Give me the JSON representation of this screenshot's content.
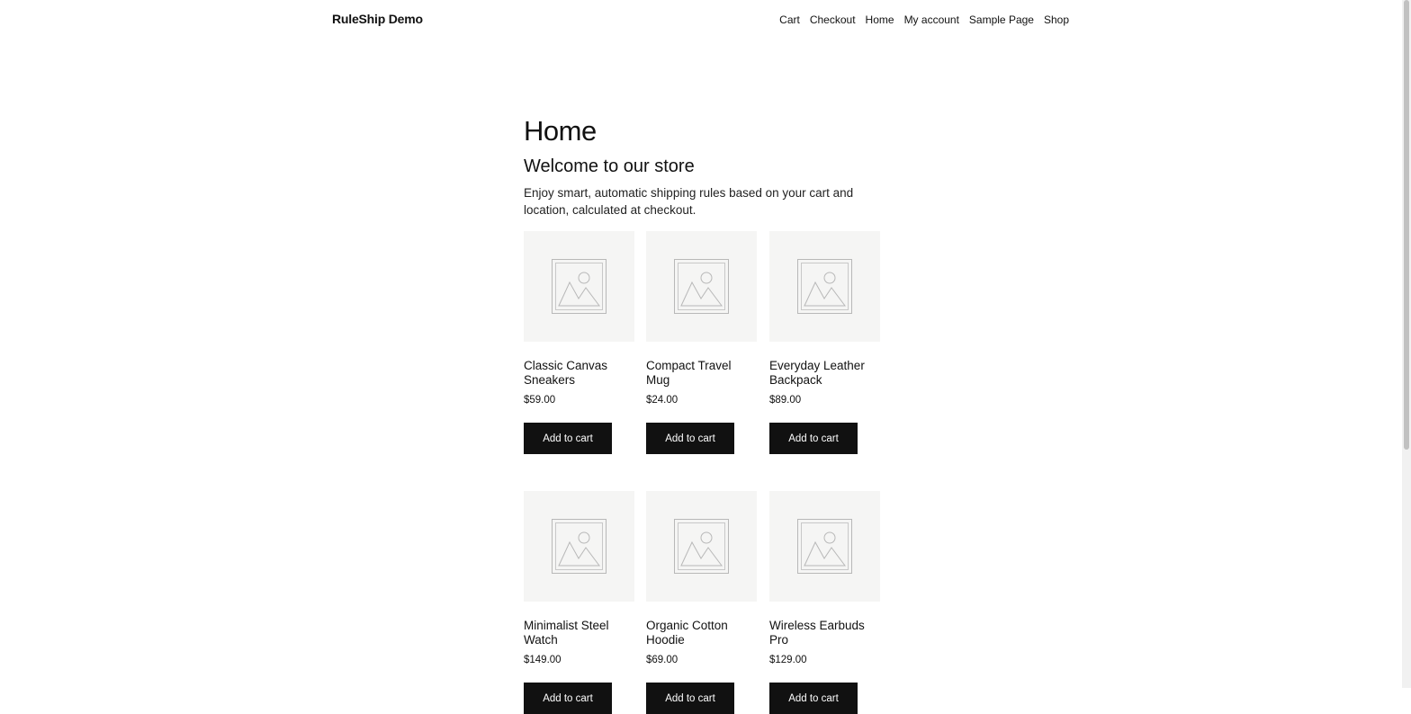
{
  "header": {
    "site_title": "RuleShip Demo",
    "nav": [
      "Cart",
      "Checkout",
      "Home",
      "My account",
      "Sample Page",
      "Shop"
    ]
  },
  "main": {
    "page_title": "Home",
    "welcome": "Welcome to our store",
    "intro": "Enjoy smart, automatic shipping rules based on your cart and location, calculated at checkout."
  },
  "products": [
    {
      "name": "Classic Canvas Sneakers",
      "price": "$59.00",
      "button": "Add to cart"
    },
    {
      "name": "Compact Travel Mug",
      "price": "$24.00",
      "button": "Add to cart"
    },
    {
      "name": "Everyday Leather Backpack",
      "price": "$89.00",
      "button": "Add to cart"
    },
    {
      "name": "Minimalist Steel Watch",
      "price": "$149.00",
      "button": "Add to cart"
    },
    {
      "name": "Organic Cotton Hoodie",
      "price": "$69.00",
      "button": "Add to cart"
    },
    {
      "name": "Wireless Earbuds Pro",
      "price": "$129.00",
      "button": "Add to cart"
    }
  ],
  "colors": {
    "background": "#ffffff",
    "text": "#111111",
    "button_bg": "#111111",
    "button_text": "#ffffff",
    "placeholder_bg": "#f5f5f4"
  },
  "icons": {
    "product_placeholder": "image-placeholder-icon"
  }
}
